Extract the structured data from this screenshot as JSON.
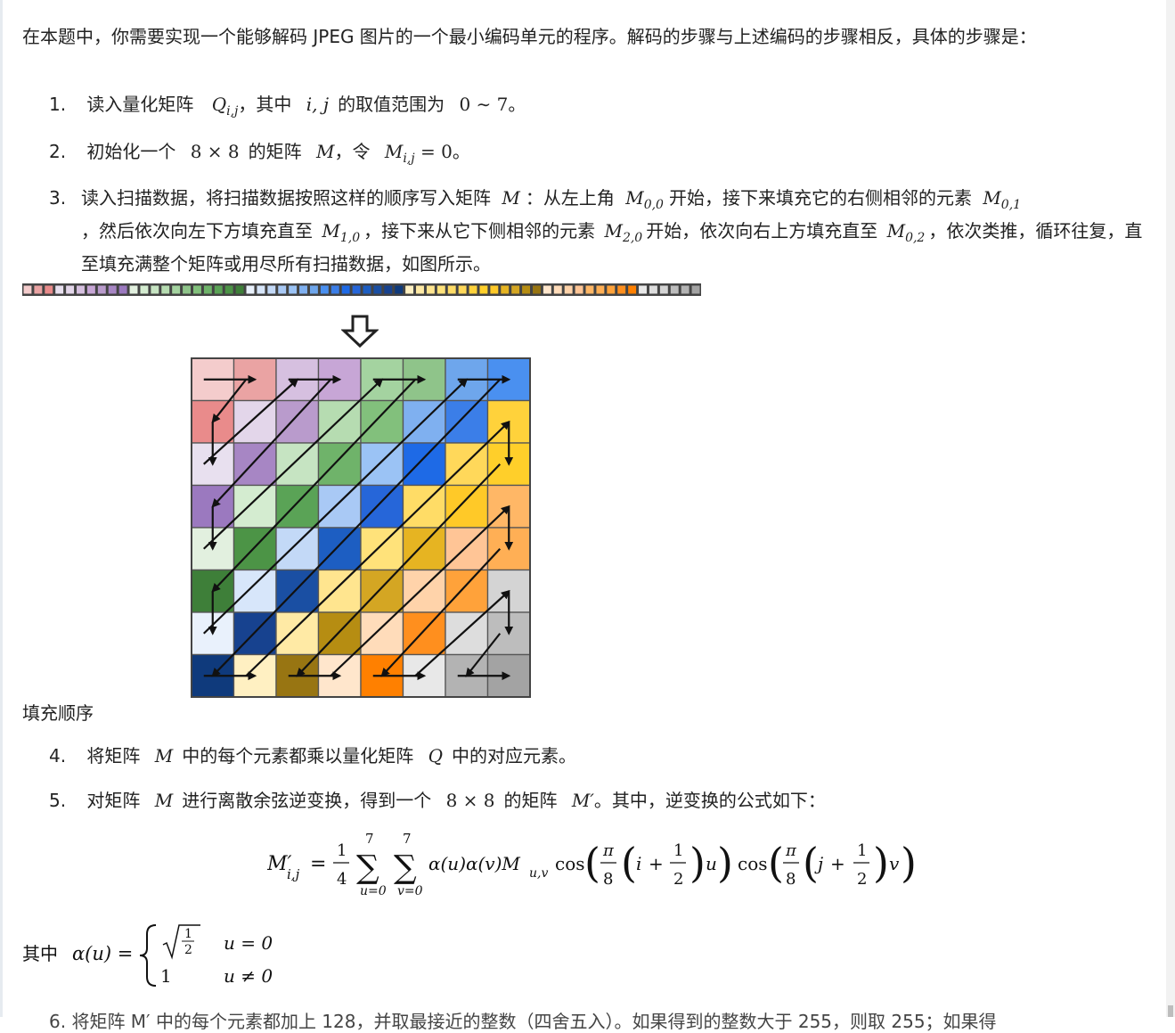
{
  "intro": "在本题中，你需要实现一个能够解码 JPEG 图片的一个最小编码单元的程序。解码的步骤与上述编码的步骤相反，具体的步骤是：",
  "steps": {
    "s1": {
      "num": "1.",
      "t1": "读入量化矩阵",
      "t2": "，其中",
      "t3": "的取值范围为",
      "t4": "。",
      "Q": "Q",
      "Qsub": "i,j",
      "ij": "i, j",
      "range": "0 ∼ 7"
    },
    "s2": {
      "num": "2.",
      "t1": "初始化一个",
      "t2": "的矩阵",
      "t3": "，令",
      "t4": "。",
      "size": "8 × 8",
      "M": "M",
      "Msub": "i,j",
      "eq": "= 0"
    },
    "s3": {
      "num": "3.",
      "t1": "读入扫描数据，将扫描数据按照这样的顺序写入矩阵",
      "t2": "：从左上角",
      "t3": "开始，接下来填充它的右侧相邻的元素",
      "t4": "，然后依次向左下方填充直至",
      "t5": "，接下来从它下侧相邻的元素",
      "t6": "开始，依次向右上方填充直至",
      "t7": "，依次类推，循环往复，直至填充满整个矩阵或用尽所有扫描数据，如图所示。",
      "M": "M",
      "s00": "0,0",
      "s01": "0,1",
      "s10": "1,0",
      "s20": "2,0",
      "s02": "0,2"
    },
    "s4": {
      "num": "4.",
      "t1": "将矩阵",
      "t2": "中的每个元素都乘以量化矩阵",
      "t3": "中的对应元素。",
      "M": "M",
      "Q": "Q"
    },
    "s5": {
      "num": "5.",
      "t1": "对矩阵",
      "t2": "进行离散余弦逆变换，得到一个",
      "t3": "的矩阵",
      "t4": "。其中，逆变换的公式如下：",
      "M": "M",
      "size": "8 × 8",
      "Mp": "M′"
    }
  },
  "caption": "填充顺序",
  "formula": {
    "lhs": "M′",
    "lhs_sub": "i,j",
    "eq": "=",
    "frac_num": "1",
    "frac_den": "4",
    "sum_top": "7",
    "sum_bot_u": "u=0",
    "sum_bot_v": "v=0",
    "body": "α(u)α(v)M",
    "body_sub": "u,v",
    "cos": "cos",
    "pi": "π",
    "eight": "8",
    "i": "i",
    "j": "j",
    "plus": "+",
    "half_num": "1",
    "half_den": "2",
    "u": "u",
    "v": "v"
  },
  "alpha_def": {
    "prefix": "其中",
    "lhs": "α(u) =",
    "sqrt_num": "1",
    "sqrt_den": "2",
    "case1": "u = 0",
    "case2_val": "1",
    "case2": "u ≠ 0"
  },
  "step6_partial": "6.  将矩阵 M′ 中的每个元素都加上 128，并取最接近的整数（四舍五入）。如果得到的整数大于 255，则取 255；如果得",
  "grid_colors": [
    [
      "#f4cccc",
      "#eaa3a3",
      "#d6c0e0",
      "#c7a6d6",
      "#a4d3a0",
      "#8fc48a",
      "#6ea6ec",
      "#4a90f0"
    ],
    [
      "#e98b8b",
      "#e3d6ea",
      "#b99bcc",
      "#b6dcb1",
      "#82c07c",
      "#7fb0f0",
      "#3b7ee8",
      "#ffd23b"
    ],
    [
      "#e8e0ef",
      "#a786c4",
      "#c6e4c2",
      "#6fb36a",
      "#9bc3f5",
      "#1e6ae6",
      "#ffd85a",
      "#ffcf2a"
    ],
    [
      "#9b79bf",
      "#d4ecd0",
      "#5aa356",
      "#a9c9f5",
      "#2666d9",
      "#ffdc66",
      "#ffc928",
      "#ffb766"
    ],
    [
      "#e2f0df",
      "#4c9446",
      "#c3d9f7",
      "#1d5ec2",
      "#ffe27a",
      "#e6b422",
      "#ffc596",
      "#ffaf55"
    ],
    [
      "#3e7f39",
      "#d7e6fa",
      "#1a4fa3",
      "#ffe58f",
      "#d4a623",
      "#ffd3aa",
      "#ffa23a",
      "#d4d4d4"
    ],
    [
      "#e9f1fc",
      "#17428f",
      "#ffeaa5",
      "#b68d12",
      "#ffdcba",
      "#ff8f1e",
      "#dddddd",
      "#bdbdbd"
    ],
    [
      "#0f3a7c",
      "#fff0c2",
      "#987512",
      "#ffe6cc",
      "#ff8000",
      "#e8e8e8",
      "#b3b3b3",
      "#a3a3a3"
    ]
  ],
  "scan_colors": [
    "#f4cccc",
    "#eaa3a3",
    "#e98b8b",
    "#e8e0ef",
    "#e3d6ea",
    "#d6c0e0",
    "#c7a6d6",
    "#b99bcc",
    "#a786c4",
    "#9b79bf",
    "#e2f0df",
    "#d4ecd0",
    "#c6e4c2",
    "#b6dcb1",
    "#a4d3a0",
    "#8fc48a",
    "#82c07c",
    "#6fb36a",
    "#5aa356",
    "#4c9446",
    "#3e7f39",
    "#e9f1fc",
    "#d7e6fa",
    "#c3d9f7",
    "#a9c9f5",
    "#9bc3f5",
    "#7fb0f0",
    "#6ea6ec",
    "#4a90f0",
    "#3b7ee8",
    "#1e6ae6",
    "#2666d9",
    "#1d5ec2",
    "#1a4fa3",
    "#17428f",
    "#0f3a7c",
    "#fff0c2",
    "#ffeaa5",
    "#ffe58f",
    "#ffe27a",
    "#ffdc66",
    "#ffd85a",
    "#ffd23b",
    "#ffcf2a",
    "#ffc928",
    "#e6b422",
    "#d4a623",
    "#b68d12",
    "#987512",
    "#ffe6cc",
    "#ffdcba",
    "#ffd3aa",
    "#ffc596",
    "#ffb766",
    "#ffaf55",
    "#ffa23a",
    "#ff8f1e",
    "#ff8000",
    "#e8e8e8",
    "#dddddd",
    "#d4d4d4",
    "#bdbdbd",
    "#b3b3b3",
    "#a3a3a3"
  ]
}
